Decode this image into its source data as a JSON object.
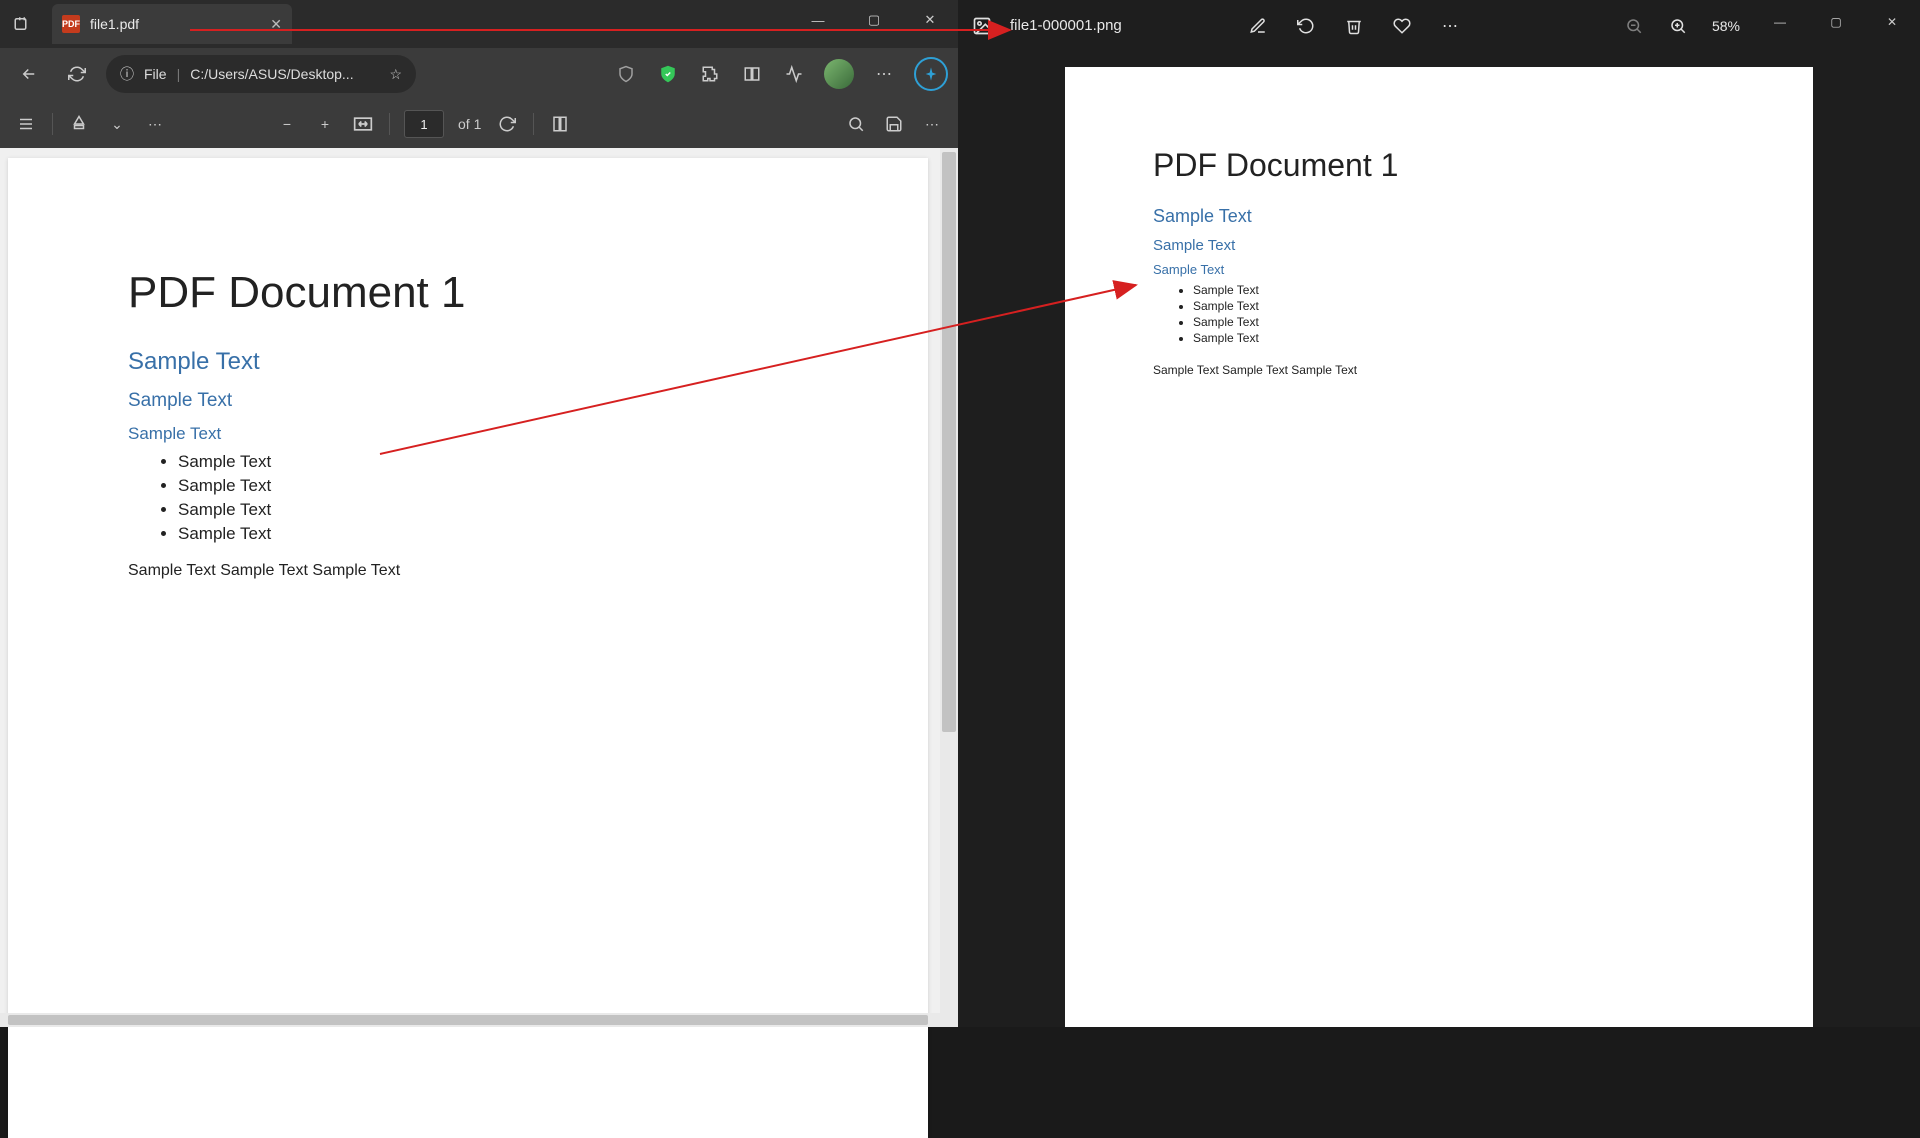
{
  "browser": {
    "tab": {
      "icon_label": "PDF",
      "title": "file1.pdf"
    },
    "address": {
      "scheme_label": "File",
      "path": "C:/Users/ASUS/Desktop..."
    },
    "pdf_toolbar": {
      "page_current": "1",
      "page_total": "of 1"
    }
  },
  "photos": {
    "filename": "file1-000001.png",
    "zoom": "58%"
  },
  "document": {
    "title": "PDF Document 1",
    "h2": "Sample Text",
    "h3": "Sample Text",
    "h4": "Sample Text",
    "bullets": [
      "Sample Text",
      "Sample Text",
      "Sample Text",
      "Sample Text"
    ],
    "paragraph": "Sample Text Sample Text Sample Text"
  }
}
